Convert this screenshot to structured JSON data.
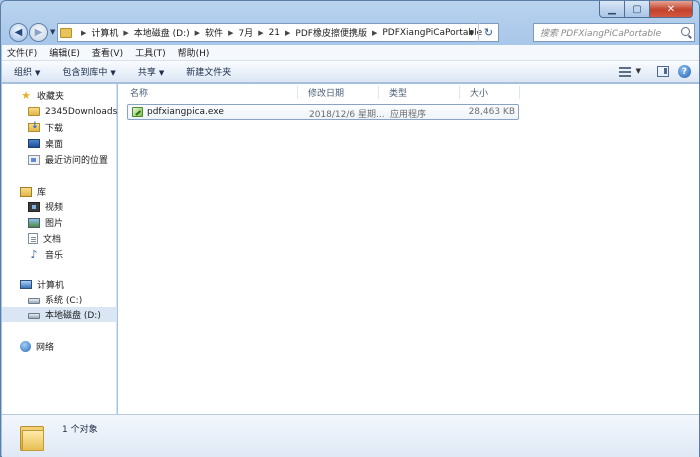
{
  "address": {
    "crumbs": [
      "计算机",
      "本地磁盘 (D:)",
      "软件",
      "7月",
      "21",
      "PDF橡皮擦便携版",
      "PDFXiangPiCaPortable"
    ]
  },
  "search": {
    "placeholder": "搜索 PDFXiangPiCaPortable"
  },
  "menu": [
    "文件(F)",
    "编辑(E)",
    "查看(V)",
    "工具(T)",
    "帮助(H)"
  ],
  "commands": {
    "organize": "组织",
    "include_in_library": "包含到库中",
    "share": "共享",
    "new_folder": "新建文件夹"
  },
  "nav": {
    "favorites": "收藏夹",
    "fav_items": [
      "2345Downloads",
      "下载",
      "桌面",
      "最近访问的位置"
    ],
    "libraries": "库",
    "lib_items": [
      "视频",
      "图片",
      "文档",
      "音乐"
    ],
    "computer": "计算机",
    "computer_items": [
      "系统 (C:)",
      "本地磁盘 (D:)"
    ],
    "network": "网络"
  },
  "columns": [
    "名称",
    "修改日期",
    "类型",
    "大小"
  ],
  "files": [
    {
      "name": "pdfxiangpica.exe",
      "modified": "2018/12/6 星期...",
      "type": "应用程序",
      "size": "28,463 KB"
    }
  ],
  "status": {
    "count": "1 个对象"
  },
  "icons": {
    "back": "arrow-left-icon",
    "forward": "arrow-right-icon",
    "refresh": "refresh-icon",
    "search": "search-icon",
    "help": "help-icon"
  }
}
